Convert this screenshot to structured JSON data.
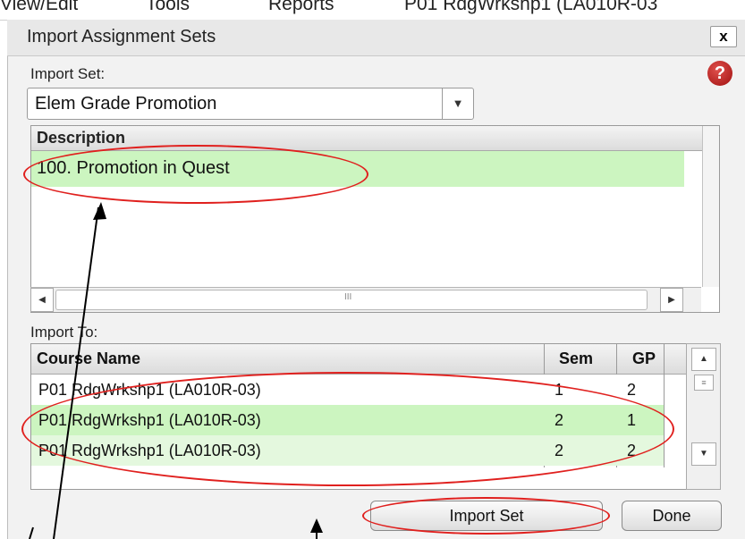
{
  "top_menu": [
    "View/Edit",
    "Tools",
    "Reports",
    "P01 RdgWrkshp1 (LA010R-03"
  ],
  "dialog": {
    "title": "Import Assignment Sets",
    "close_label": "x",
    "help_label": "?"
  },
  "import_set": {
    "label": "Import Set:",
    "selected": "Elem Grade Promotion"
  },
  "description_grid": {
    "header": "Description",
    "rows": [
      "100. Promotion in Quest"
    ],
    "scroll_thumb": "III"
  },
  "import_to": {
    "label": "Import To:",
    "columns": [
      "Course Name",
      "Sem",
      "GP"
    ],
    "rows": [
      {
        "course": "P01  RdgWrkshp1 (LA010R-03)",
        "sem": "1",
        "gp": "2"
      },
      {
        "course": "P01  RdgWrkshp1 (LA010R-03)",
        "sem": "2",
        "gp": "1"
      },
      {
        "course": "P01  RdgWrkshp1 (LA010R-03)",
        "sem": "2",
        "gp": "2"
      }
    ]
  },
  "buttons": {
    "import_set": "Import Set",
    "done": "Done"
  },
  "colors": {
    "selected_row": "#ccf5c0",
    "annotation": "#e0201e"
  }
}
